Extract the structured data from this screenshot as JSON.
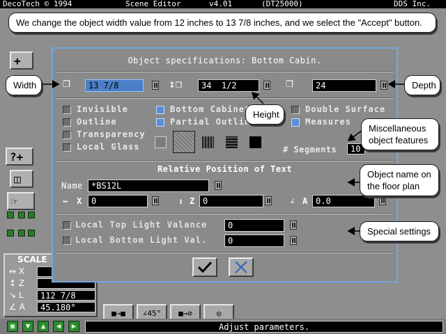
{
  "titlebar": {
    "app": "DecoTech © 1994",
    "editor": "Scene Editor",
    "version": "v4.01",
    "build": "(DT25000)",
    "company": "DDS Inc."
  },
  "caption": "We change the object width value from 12 inches to 13 7/8 inches, and we select the \"Accept\" button.",
  "dialog": {
    "title": "Object specifications: Bottom Cabin.",
    "width_value": "13 7/8",
    "height_value": "34  1/2",
    "depth_value": "24",
    "checkboxes": [
      {
        "label": "Invisible",
        "checked": false
      },
      {
        "label": "Outline",
        "checked": false
      },
      {
        "label": "Transparency",
        "checked": false
      },
      {
        "label": "Local Glass",
        "checked": false
      },
      {
        "label": "Bottom Cabinet",
        "checked": true
      },
      {
        "label": "Partial Outline",
        "checked": true
      },
      {
        "label": "Double Surface",
        "checked": false
      },
      {
        "label": "Measures",
        "checked": true
      }
    ],
    "segments_label": "# Segments",
    "segments_value": "10",
    "text_position_title": "Relative Position of Text",
    "name_label": "Name",
    "name_value": "*BS12L",
    "x_label": "X",
    "x_value": "0",
    "z_label": "Z",
    "z_value": "0",
    "a_label": "A",
    "a_value": "0.0",
    "light_valance_label": "Local Top Light Valance",
    "light_valance_value": "0",
    "light_bottom_label": "Local Bottom Light Val.",
    "light_bottom_value": "0",
    "accept_icon": "checkmark-icon",
    "cancel_icon": "cross-icon"
  },
  "callouts": {
    "width": "Width",
    "height": "Height",
    "depth": "Depth",
    "misc": "Miscellaneous object features",
    "name": "Object name on the floor plan",
    "special": "Special settings"
  },
  "scale_panel": {
    "title": "SCALE",
    "x_value": "",
    "z_value": "",
    "l_value": "112  7/8",
    "a_value": "45.180°"
  },
  "status": {
    "message": "Adjust parameters."
  },
  "bottom_tools": {
    "rotate_label": "45°"
  },
  "colors": {
    "accent": "#5a8ed6",
    "dialog_border": "#6fa8e0"
  }
}
